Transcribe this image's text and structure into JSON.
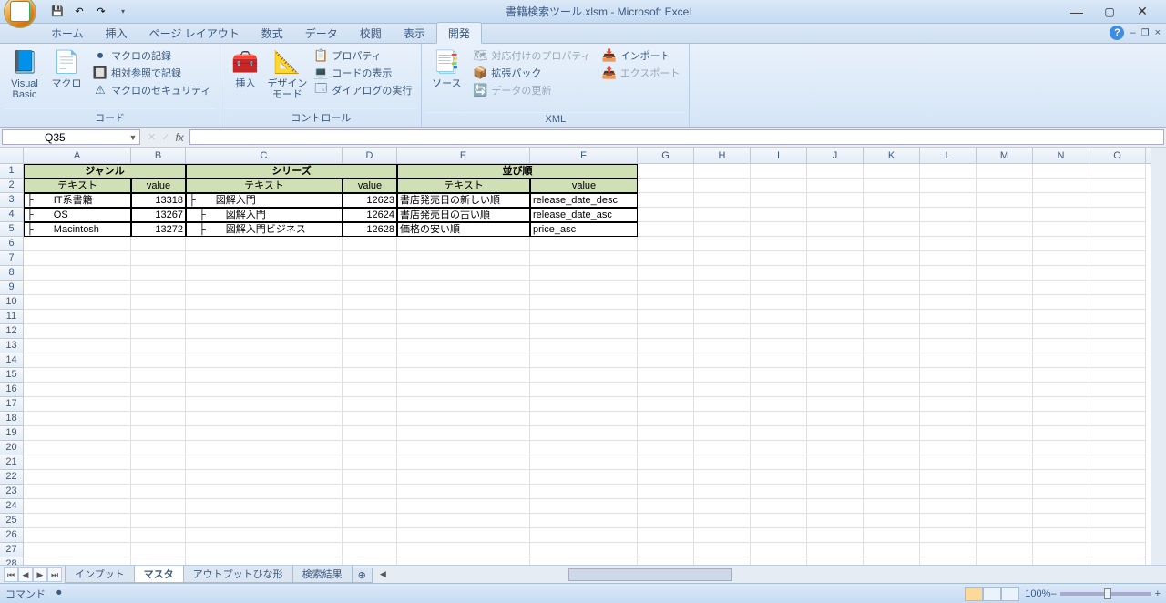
{
  "title": "書籍検索ツール.xlsm - Microsoft Excel",
  "qat": {
    "save": "💾",
    "undo": "↶",
    "redo": "↷"
  },
  "tabs": {
    "home": "ホーム",
    "insert": "挿入",
    "layout": "ページ レイアウト",
    "formula": "数式",
    "data": "データ",
    "review": "校閲",
    "view": "表示",
    "dev": "開発"
  },
  "ribbon": {
    "code": {
      "vb": "Visual\nBasic",
      "macro": "マクロ",
      "rec": "マクロの記録",
      "relref": "相対参照で記録",
      "sec": "マクロのセキュリティ",
      "label": "コード"
    },
    "ctrl": {
      "insert": "挿入",
      "design": "デザイン\nモード",
      "prop": "プロパティ",
      "viewcode": "コードの表示",
      "dialog": "ダイアログの実行",
      "label": "コントロール"
    },
    "xml": {
      "source": "ソース",
      "mapprop": "対応付けのプロパティ",
      "exp": "拡張パック",
      "refresh": "データの更新",
      "import": "インポート",
      "export": "エクスポート",
      "label": "XML"
    }
  },
  "namebox": "Q35",
  "fx": "fx",
  "colHeads": [
    "A",
    "B",
    "C",
    "D",
    "E",
    "F",
    "G",
    "H",
    "I",
    "J",
    "K",
    "L",
    "M",
    "N",
    "O"
  ],
  "headers1": {
    "genre": "ジャンル",
    "series": "シリーズ",
    "sort": "並び順"
  },
  "headers2": {
    "text": "テキスト",
    "value": "value"
  },
  "rows": [
    {
      "a": "├　　IT系書籍",
      "b": "13318",
      "c": "├　　図解入門",
      "d": "12623",
      "e": "書店発売日の新しい順",
      "f": "release_date_desc"
    },
    {
      "a": "├　　OS",
      "b": "13267",
      "c": "　├　　図解入門",
      "d": "12624",
      "e": "書店発売日の古い順",
      "f": "release_date_asc"
    },
    {
      "a": "├　　Macintosh",
      "b": "13272",
      "c": "　├　　図解入門ビジネス",
      "d": "12628",
      "e": "価格の安い順",
      "f": "price_asc"
    }
  ],
  "sheetTabs": {
    "t1": "インプット",
    "t2": "マスタ",
    "t3": "アウトプットひな形",
    "t4": "検索結果"
  },
  "status": {
    "mode": "コマンド",
    "zoom": "100%"
  }
}
